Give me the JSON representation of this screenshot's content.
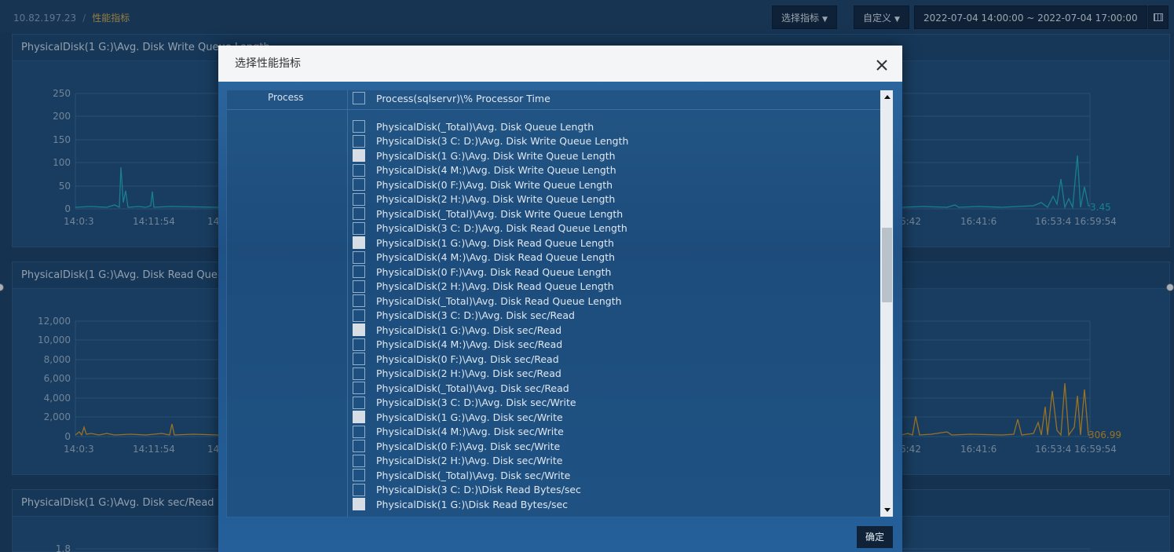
{
  "breadcrumb": {
    "host": "10.82.197.23",
    "separator": "/",
    "current": "性能指标"
  },
  "toolbar": {
    "select_metric_label": "选择指标",
    "custom_label": "自定义",
    "time_range": "2022-07-04 14:00:00 ~ 2022-07-04 17:00:00"
  },
  "colors": {
    "series_cyan": "#21b6c6",
    "series_orange": "#e8a11e",
    "accent_crumb": "#e0b24a"
  },
  "panels": [
    {
      "title": "PhysicalDisk(1 G:)\\Avg. Disk Write Queue Length",
      "y_ticks": [
        "250",
        "200",
        "150",
        "100",
        "50",
        "0"
      ],
      "x_ticks_left": [
        "14:0:3",
        "14:11:54",
        "14"
      ],
      "x_ticks_right": [
        "6:42",
        "16:41:6",
        "16:53:4",
        "16:59:54"
      ],
      "last_value": "3.45"
    },
    {
      "title": "PhysicalDisk(1 G:)\\Avg. Disk Read Queu",
      "y_ticks": [
        "12,000",
        "10,000",
        "8,000",
        "6,000",
        "4,000",
        "2,000",
        "0"
      ],
      "x_ticks_left": [
        "14:0:3",
        "14:11:54",
        "14"
      ],
      "x_ticks_right": [
        "6:42",
        "16:41:6",
        "16:53:4",
        "16:59:54"
      ],
      "last_value": "306.99"
    },
    {
      "title": "PhysicalDisk(1 G:)\\Avg. Disk sec/Read",
      "y_ticks": [
        "1.8"
      ]
    }
  ],
  "modal": {
    "title": "选择性能指标",
    "confirm_label": "确定",
    "group_label": "Process",
    "items": [
      {
        "label": "Process(sqlservr)\\% Processor Time",
        "checked": false
      },
      {
        "label": "PhysicalDisk(_Total)\\Avg. Disk Queue Length",
        "checked": false
      },
      {
        "label": "PhysicalDisk(3 C: D:)\\Avg. Disk Write Queue Length",
        "checked": false
      },
      {
        "label": "PhysicalDisk(1 G:)\\Avg. Disk Write Queue Length",
        "checked": true
      },
      {
        "label": "PhysicalDisk(4 M:)\\Avg. Disk Write Queue Length",
        "checked": false
      },
      {
        "label": "PhysicalDisk(0 F:)\\Avg. Disk Write Queue Length",
        "checked": false
      },
      {
        "label": "PhysicalDisk(2 H:)\\Avg. Disk Write Queue Length",
        "checked": false
      },
      {
        "label": "PhysicalDisk(_Total)\\Avg. Disk Write Queue Length",
        "checked": false
      },
      {
        "label": "PhysicalDisk(3 C: D:)\\Avg. Disk Read Queue Length",
        "checked": false
      },
      {
        "label": "PhysicalDisk(1 G:)\\Avg. Disk Read Queue Length",
        "checked": true
      },
      {
        "label": "PhysicalDisk(4 M:)\\Avg. Disk Read Queue Length",
        "checked": false
      },
      {
        "label": "PhysicalDisk(0 F:)\\Avg. Disk Read Queue Length",
        "checked": false
      },
      {
        "label": "PhysicalDisk(2 H:)\\Avg. Disk Read Queue Length",
        "checked": false
      },
      {
        "label": "PhysicalDisk(_Total)\\Avg. Disk Read Queue Length",
        "checked": false
      },
      {
        "label": "PhysicalDisk(3 C: D:)\\Avg. Disk sec/Read",
        "checked": false
      },
      {
        "label": "PhysicalDisk(1 G:)\\Avg. Disk sec/Read",
        "checked": true
      },
      {
        "label": "PhysicalDisk(4 M:)\\Avg. Disk sec/Read",
        "checked": false
      },
      {
        "label": "PhysicalDisk(0 F:)\\Avg. Disk sec/Read",
        "checked": false
      },
      {
        "label": "PhysicalDisk(2 H:)\\Avg. Disk sec/Read",
        "checked": false
      },
      {
        "label": "PhysicalDisk(_Total)\\Avg. Disk sec/Read",
        "checked": false
      },
      {
        "label": "PhysicalDisk(3 C: D:)\\Avg. Disk sec/Write",
        "checked": false
      },
      {
        "label": "PhysicalDisk(1 G:)\\Avg. Disk sec/Write",
        "checked": true
      },
      {
        "label": "PhysicalDisk(4 M:)\\Avg. Disk sec/Write",
        "checked": false
      },
      {
        "label": "PhysicalDisk(0 F:)\\Avg. Disk sec/Write",
        "checked": false
      },
      {
        "label": "PhysicalDisk(2 H:)\\Avg. Disk sec/Write",
        "checked": false
      },
      {
        "label": "PhysicalDisk(_Total)\\Avg. Disk sec/Write",
        "checked": false
      },
      {
        "label": "PhysicalDisk(3 C: D:)\\Disk Read Bytes/sec",
        "checked": false
      },
      {
        "label": "PhysicalDisk(1 G:)\\Disk Read Bytes/sec",
        "checked": true
      }
    ]
  }
}
